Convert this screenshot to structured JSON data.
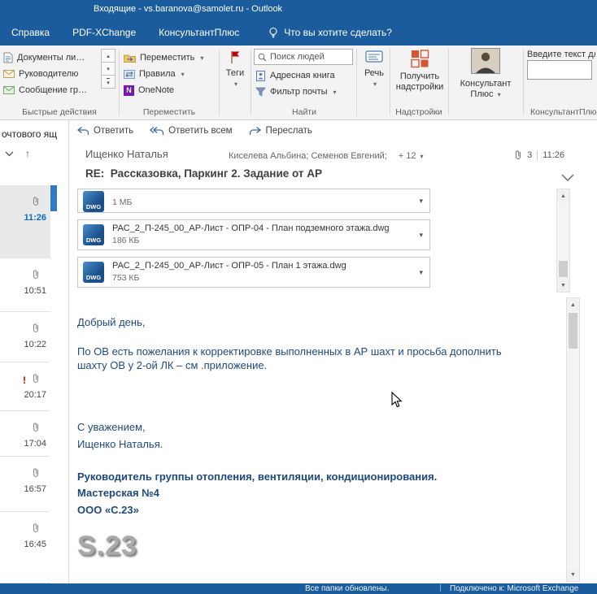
{
  "window": {
    "title": "Входящие - vs.baranova@samolet.ru  -  Outlook"
  },
  "tabs": {
    "help": "Справка",
    "pdfxchange": "PDF-XChange",
    "consultant": "КонсультантПлюс",
    "tellme": "Что вы хотите сделать?"
  },
  "ribbon": {
    "quick_steps": {
      "items": [
        {
          "label": "Документы ли…"
        },
        {
          "label": "Руководителю"
        },
        {
          "label": "Сообщение гр…"
        }
      ]
    },
    "move": {
      "move_label": "Переместить",
      "rules_label": "Правила",
      "onenote_label": "OneNote",
      "onenote_initial": "N"
    },
    "tags_label": "Теги",
    "find": {
      "search_people_placeholder": "Поиск людей",
      "address_book_label": "Адресная книга",
      "mail_filter_label": "Фильтр почты"
    },
    "speech_label": "Речь",
    "addins_line1": "Получить",
    "addins_line2": "надстройки",
    "consultant_line1": "Консультант",
    "consultant_line2": "Плюс",
    "consultant_search_label": "Введите текст для"
  },
  "group_labels": {
    "quick_steps": "Быстрые действия",
    "move": "Переместить",
    "find": "Найти",
    "addins": "Надстройки",
    "consultant": "КонсультантПлюс"
  },
  "folder_pane": {
    "search_fragment": "очтового ящ"
  },
  "message_list": {
    "items": [
      {
        "time": "11:26"
      },
      {
        "time": "10:51"
      },
      {
        "time": "10:22"
      },
      {
        "time": "20:17",
        "importance": "!"
      },
      {
        "time": "17:04"
      },
      {
        "time": "16:57"
      },
      {
        "time": "16:45"
      }
    ]
  },
  "reading_pane": {
    "actions": {
      "reply": "Ответить",
      "reply_all": "Ответить всем",
      "forward": "Переслать"
    },
    "sender": "Ищенко Наталья",
    "recipients": "Киселева Альбина; Семенов Евгений;",
    "recipients_more": "+ 12",
    "attachments_count": "3",
    "received_time": "11:26",
    "subject": "RE:  Рассказовка, Паркинг 2. Задание от АР",
    "dwg_badge": "DWG",
    "attachments": [
      {
        "name": "",
        "size": "1 МБ"
      },
      {
        "name": "РАС_2_П-245_00_АР-Лист - ОПР-04 - План подземного этажа.dwg",
        "size": "186 КБ"
      },
      {
        "name": "РАС_2_П-245_00_АР-Лист - ОПР-05 - План 1 этажа.dwg",
        "size": "753 КБ"
      }
    ],
    "body": {
      "line1": "Добрый день,",
      "line2": "По ОВ есть пожелания к корректировке выполненных в АР шахт и просьба дополнить шахту ОВ у 2-ой ЛК – см .приложение.",
      "sig_line1": "С уважением,",
      "sig_line2": "Ищенко Наталья.",
      "sig_line3": "Руководитель группы отопления, вентиляции, кондиционирования.",
      "sig_line4": "Мастерская №4",
      "sig_line5": "ООО «С.23»",
      "logo_text": "S.23"
    }
  },
  "status_bar": {
    "left": "Все папки обновлены.",
    "right": "Подключено к:  Microsoft Exchange"
  },
  "icons": {
    "caret_down": "▾",
    "qs_up": "▴",
    "qs_down": "▾",
    "qs_more": "▾",
    "scroll_up": "▲",
    "scroll_down": "▼",
    "sort_arrow": "↑"
  },
  "colors": {
    "titlebar_blue": "#1b5c9d",
    "body_text_blue": "#1f497d",
    "unread_time_blue": "#0a6ebd",
    "importance_red": "#c00000",
    "dwg_icon_blue": "#1b4f8a"
  }
}
